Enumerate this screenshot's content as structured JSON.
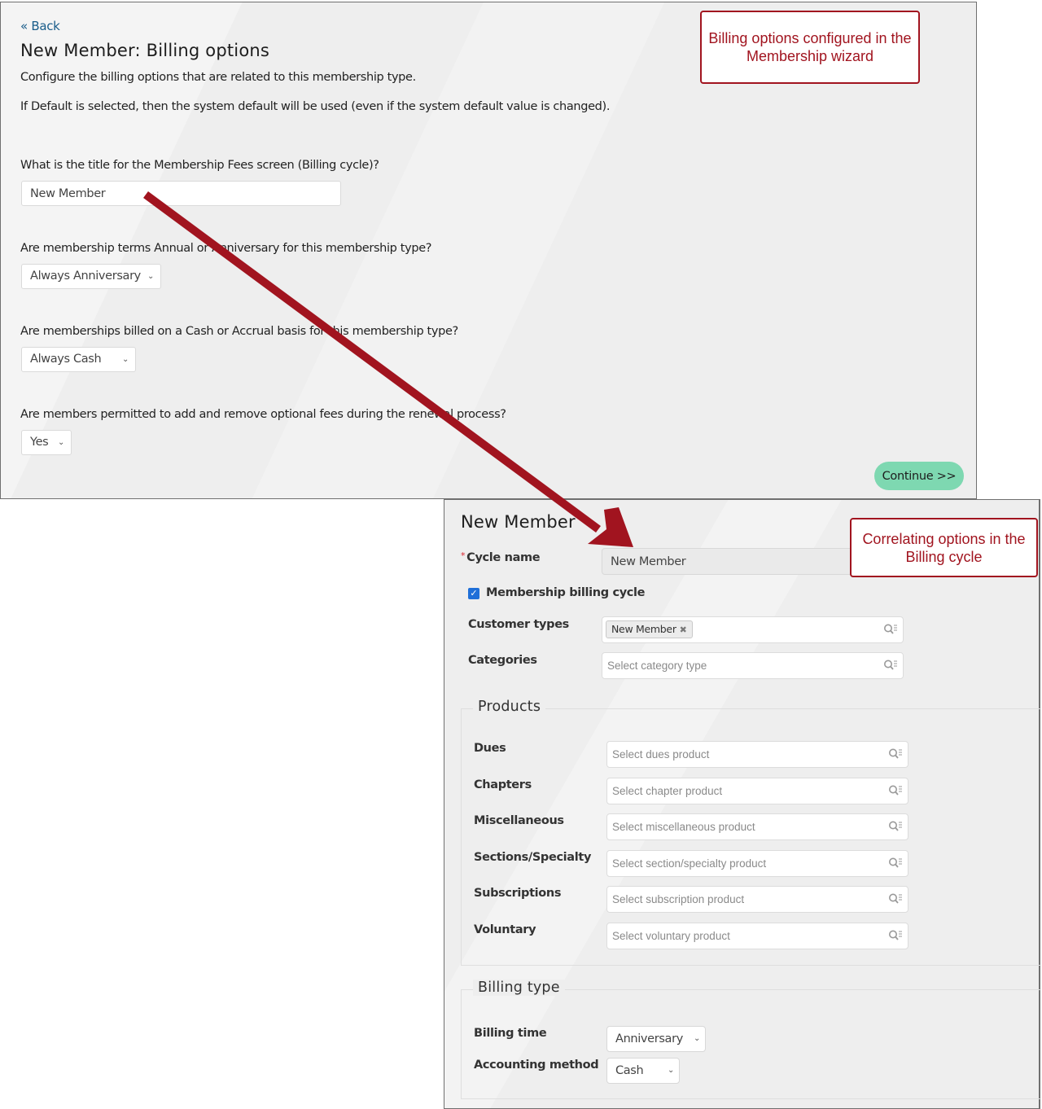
{
  "wizard": {
    "back_label": "« Back",
    "title": "New Member: Billing options",
    "intro_line1": "Configure the billing options that are related to this membership type.",
    "intro_line2": "If Default is selected, then the system default will be used (even if the system default value is changed).",
    "questions": [
      {
        "label": "What is the title for the Membership Fees screen (Billing cycle)?",
        "type": "text",
        "value": "New Member"
      },
      {
        "label": "Are membership terms Annual or Anniversary for this membership type?",
        "type": "select",
        "value": "Always Anniversary"
      },
      {
        "label": "Are memberships billed on a Cash or Accrual basis for this membership type?",
        "type": "select",
        "value": "Always Cash"
      },
      {
        "label": "Are members permitted to add and remove optional fees during the renewal process?",
        "type": "select",
        "value": "Yes"
      }
    ],
    "continue_label": "Continue >>"
  },
  "callouts": {
    "top": "Billing options configured in the Membership wizard",
    "bottom": "Correlating options in the Billing cycle"
  },
  "billing_cycle": {
    "title": "New Member",
    "cycle_name_label": "Cycle name",
    "required_marker": "*",
    "cycle_name_value": "New Member",
    "membership_checkbox_label": "Membership billing cycle",
    "membership_checkbox_checked": true,
    "customer_types_label": "Customer types",
    "customer_types_tags": [
      "New Member"
    ],
    "categories_label": "Categories",
    "categories_placeholder": "Select category type",
    "products_legend": "Products",
    "products": [
      {
        "label": "Dues",
        "placeholder": "Select dues product"
      },
      {
        "label": "Chapters",
        "placeholder": "Select chapter product"
      },
      {
        "label": "Miscellaneous",
        "placeholder": "Select miscellaneous product"
      },
      {
        "label": "Sections/Specialty",
        "placeholder": "Select section/specialty product"
      },
      {
        "label": "Subscriptions",
        "placeholder": "Select subscription product"
      },
      {
        "label": "Voluntary",
        "placeholder": "Select voluntary product"
      }
    ],
    "billing_type_legend": "Billing type",
    "billing_time_label": "Billing time",
    "billing_time_value": "Anniversary",
    "accounting_method_label": "Accounting method",
    "accounting_method_value": "Cash"
  },
  "colors": {
    "callout": "#a1141f",
    "arrow": "#a1141f",
    "continue_button": "#7ed8b1",
    "link": "#1a5d8a",
    "checkbox": "#1f6fd8"
  }
}
